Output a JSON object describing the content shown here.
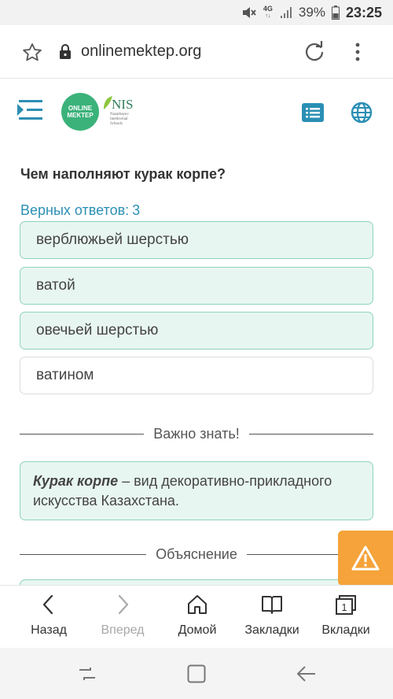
{
  "status_bar": {
    "network_top": "4G",
    "network_bottom": "↑↓",
    "battery": "39%",
    "time": "23:25"
  },
  "browser": {
    "url": "onlinemektep.org",
    "toolbar": {
      "back": "Назад",
      "forward": "Вперед",
      "home": "Домой",
      "bookmarks": "Закладки",
      "tabs": "Вкладки",
      "tabs_count": "1"
    }
  },
  "header": {
    "logo_line1": "ONLINE",
    "logo_line2": "MEKTEP",
    "nis_logo": "NIS",
    "nis_sub1": "Nazarbayev",
    "nis_sub2": "Intellectual",
    "nis_sub3": "Schools"
  },
  "quiz": {
    "question": "Чем наполняют курак корпе?",
    "answers_label": "Верных ответов:",
    "answers_value": "3",
    "options": [
      {
        "text": "верблюжьей шерстью",
        "highlighted": true
      },
      {
        "text": "ватой",
        "highlighted": true
      },
      {
        "text": "овечьей шерстью",
        "highlighted": true
      },
      {
        "text": "ватином",
        "highlighted": false
      }
    ],
    "important_title": "Важно знать!",
    "info_term": "Курак корпе",
    "info_rest": " – вид декоративно-прикладного искусства Казахстана.",
    "explanation_title": "Объяснение"
  },
  "colors": {
    "accent_text": "#2b8fb4",
    "selected_bg": "#e8f6f1",
    "selected_border": "#8fd3bd",
    "warning": "#f5a33a",
    "logo_green": "#3bb27a"
  }
}
